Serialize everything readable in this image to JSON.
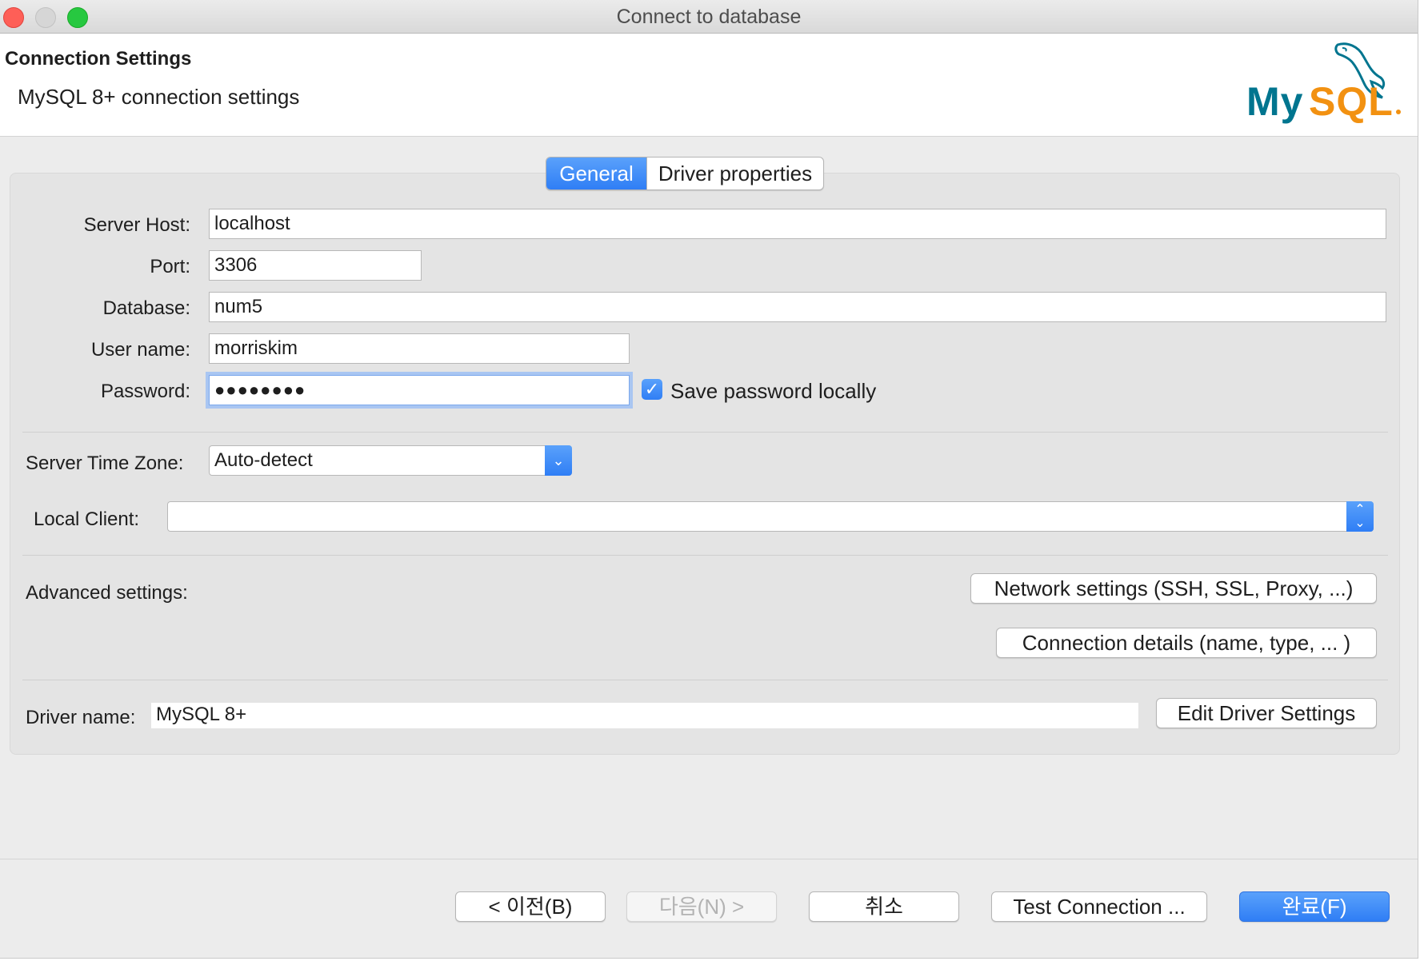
{
  "window": {
    "title": "Connect to database"
  },
  "header": {
    "title": "Connection Settings",
    "subtitle": "MySQL 8+ connection settings",
    "logo_text": "MySQL"
  },
  "tabs": [
    {
      "label": "General",
      "active": true
    },
    {
      "label": "Driver properties",
      "active": false
    }
  ],
  "form": {
    "server_host": {
      "label": "Server Host:",
      "value": "localhost"
    },
    "port": {
      "label": "Port:",
      "value": "3306"
    },
    "database": {
      "label": "Database:",
      "value": "num5"
    },
    "user_name": {
      "label": "User name:",
      "value": "morriskim"
    },
    "password": {
      "label": "Password:",
      "value": "●●●●●●●●"
    },
    "save_password": {
      "label": "Save password locally",
      "checked": true
    },
    "server_time_zone": {
      "label": "Server Time Zone:",
      "value": "Auto-detect"
    },
    "local_client": {
      "label": "Local Client:",
      "value": ""
    },
    "advanced": {
      "label": "Advanced settings:"
    },
    "network_button": "Network settings (SSH, SSL, Proxy, ...)",
    "connection_details_button": "Connection details (name, type, ... )",
    "driver_name": {
      "label": "Driver name:",
      "value": "MySQL 8+"
    },
    "edit_driver_button": "Edit Driver Settings"
  },
  "footer": {
    "back": "< 이전(B)",
    "next": "다음(N) >",
    "cancel": "취소",
    "test": "Test Connection ...",
    "finish": "완료(F)"
  },
  "colors": {
    "accent": "#2f7ef5",
    "logo_teal": "#00758f",
    "logo_orange": "#f29111"
  }
}
